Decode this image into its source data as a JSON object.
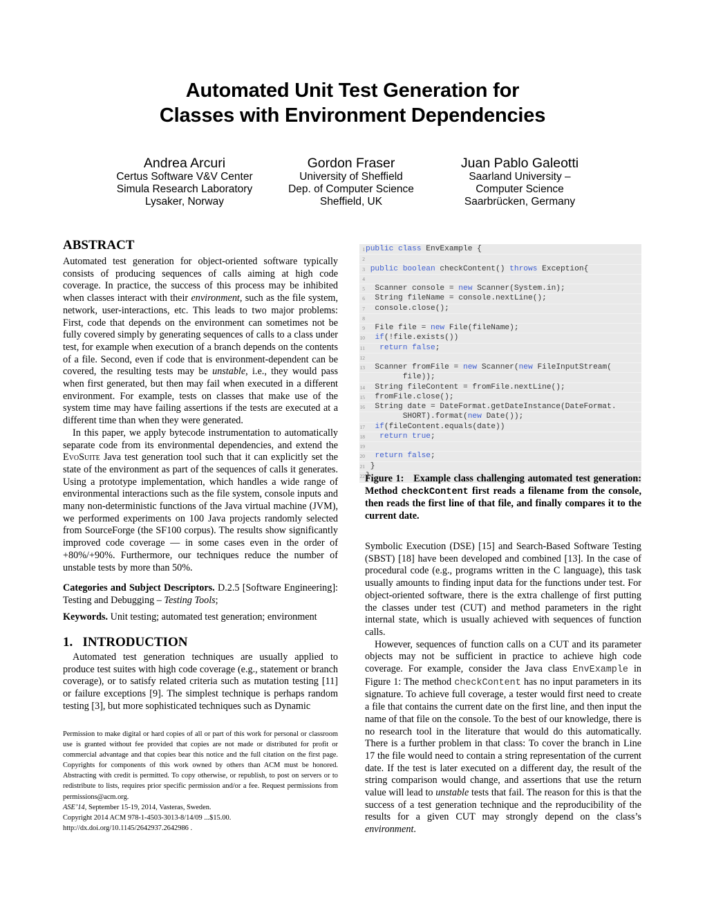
{
  "paper": {
    "title_line1": "Automated Unit Test Generation for",
    "title_line2": "Classes with Environment Dependencies",
    "authors": [
      {
        "name": "Andrea Arcuri",
        "affiliation": [
          "Certus Software V&V Center",
          "Simula Research Laboratory",
          "Lysaker, Norway"
        ]
      },
      {
        "name": "Gordon Fraser",
        "affiliation": [
          "University of Sheffield",
          "Dep. of Computer Science",
          "Sheffield, UK"
        ]
      },
      {
        "name": "Juan Pablo Galeotti",
        "affiliation": [
          "Saarland University –",
          "Computer Science",
          "Saarbrücken, Germany"
        ]
      }
    ]
  },
  "abstract": {
    "heading": "ABSTRACT",
    "p1_a": "Automated test generation for object-oriented software typically consists of producing sequences of calls aiming at high code coverage. In practice, the success of this process may be inhibited when classes interact with their ",
    "p1_em1": "environment",
    "p1_b": ", such as the file system, network, user-interactions, etc. This leads to two major problems: First, code that depends on the environment can sometimes not be fully covered simply by generating sequences of calls to a class under test, for example when execution of a branch depends on the contents of a file. Second, even if code that is environment-dependent can be covered, the resulting tests may be ",
    "p1_em2": "unstable",
    "p1_c": ", i.e., they would pass when first generated, but then may fail when executed in a different environment. For example, tests on classes that make use of the system time may have failing assertions if the tests are executed at a different time than when they were generated.",
    "p2_a": "In this paper, we apply bytecode instrumentation to automatically separate code from its environmental dependencies, and extend the ",
    "p2_tool": "EvoSuite",
    "p2_b": " Java test generation tool such that it can explicitly set the state of the environment as part of the sequences of calls it generates. Using a prototype implementation, which handles a wide range of environmental interactions such as the file system, console inputs and many non-deterministic functions of the Java virtual machine (JVM), we performed experiments on 100 Java projects randomly selected from SourceForge (the SF100 corpus). The results show significantly improved code coverage — in some cases even in the order of +80%/+90%. Furthermore, our techniques reduce the number of unstable tests by more than 50%."
  },
  "categories": {
    "label": "Categories and Subject Descriptors.",
    "text_a": " D.2.5 [Software Engineering]: Testing and Debugging – ",
    "text_em": "Testing Tools",
    "text_b": ";"
  },
  "keywords": {
    "label": "Keywords.",
    "text": " Unit testing; automated test generation; environment"
  },
  "introduction": {
    "heading": "1.   INTRODUCTION",
    "p1_left": "Automated test generation techniques are usually applied to produce test suites with high code coverage (e.g., statement or branch coverage), or to satisfy related criteria such as mutation testing [11] or failure exceptions [9]. The simplest technique is perhaps random testing [3], but more sophisticated techniques such as Dynamic",
    "p1_right": "Symbolic Execution (DSE) [15] and Search-Based Software Testing (SBST) [18] have been developed and combined [13]. In the case of procedural code (e.g., programs written in the C language), this task usually amounts to finding input data for the functions under test. For object-oriented software, there is the extra challenge of first putting the classes under test (CUT) and method parameters in the right internal state, which is usually achieved with sequences of function calls.",
    "p2_a": "However, sequences of function calls on a CUT and its parameter objects may not be sufficient in practice to achieve high code coverage. For example, consider the Java class ",
    "p2_code1": "EnvExample",
    "p2_b": " in Figure 1: The method ",
    "p2_code2": "checkContent",
    "p2_c": " has no input parameters in its signature. To achieve full coverage, a tester would first need to create a file that contains the current date on the first line, and then input the name of that file on the console. To the best of our knowledge, there is no research tool in the literature that would do this automatically. There is a further problem in that class: To cover the branch in Line 17 the file would need to contain a string representation of the current date. If the test is later executed on a different day, the result of the string comparison would change, and assertions that use the return value will lead to ",
    "p2_em1": "unstable",
    "p2_d": " tests that fail. The reason for this is that the success of a test generation technique and the reproducibility of the results for a given CUT may strongly depend on the class’s ",
    "p2_em2": "environment",
    "p2_e": "."
  },
  "permission": {
    "text": "Permission to make digital or hard copies of all or part of this work for personal or classroom use is granted without fee provided that copies are not made or distributed for profit or commercial advantage and that copies bear this notice and the full citation on the first page. Copyrights for components of this work owned by others than ACM must be honored. Abstracting with credit is permitted. To copy otherwise, or republish, to post on servers or to redistribute to lists, requires prior specific permission and/or a fee. Request permissions from permissions@acm.org.",
    "venue_em": "ASE’14,",
    "venue": " September 15-19, 2014, Vasteras, Sweden.",
    "copyright": "Copyright 2014 ACM 978-1-4503-3013-8/14/09 ...$15.00.",
    "doi": "http://dx.doi.org/10.1145/2642937.2642986 ."
  },
  "figure1": {
    "keyword_color": "#3f5fd0",
    "background_color": "#e9e9e9",
    "code_lines": [
      {
        "n": "1",
        "segs": [
          [
            "kw",
            "public class"
          ],
          [
            "t",
            " EnvExample {"
          ]
        ]
      },
      {
        "n": "2",
        "segs": []
      },
      {
        "n": "3",
        "segs": [
          [
            "t",
            " "
          ],
          [
            "kw",
            "public boolean"
          ],
          [
            "t",
            " checkContent() "
          ],
          [
            "kw",
            "throws"
          ],
          [
            "t",
            " Exception{"
          ]
        ]
      },
      {
        "n": "4",
        "segs": []
      },
      {
        "n": "5",
        "segs": [
          [
            "t",
            "  Scanner console = "
          ],
          [
            "kw",
            "new"
          ],
          [
            "t",
            " Scanner(System.in);"
          ]
        ]
      },
      {
        "n": "6",
        "segs": [
          [
            "t",
            "  String fileName = console.nextLine();"
          ]
        ]
      },
      {
        "n": "7",
        "segs": [
          [
            "t",
            "  console.close();"
          ]
        ]
      },
      {
        "n": "8",
        "segs": []
      },
      {
        "n": "9",
        "segs": [
          [
            "t",
            "  File file = "
          ],
          [
            "kw",
            "new"
          ],
          [
            "t",
            " File(fileName);"
          ]
        ]
      },
      {
        "n": "10",
        "segs": [
          [
            "t",
            "  "
          ],
          [
            "kw",
            "if"
          ],
          [
            "t",
            "(!file.exists())"
          ]
        ]
      },
      {
        "n": "11",
        "segs": [
          [
            "t",
            "   "
          ],
          [
            "kw",
            "return false"
          ],
          [
            "t",
            ";"
          ]
        ]
      },
      {
        "n": "12",
        "segs": []
      },
      {
        "n": "13",
        "segs": [
          [
            "t",
            "  Scanner fromFile = "
          ],
          [
            "kw",
            "new"
          ],
          [
            "t",
            " Scanner("
          ],
          [
            "kw",
            "new"
          ],
          [
            "t",
            " FileInputStream("
          ]
        ]
      },
      {
        "n": "",
        "segs": [
          [
            "t",
            "        file));"
          ]
        ]
      },
      {
        "n": "14",
        "segs": [
          [
            "t",
            "  String fileContent = fromFile.nextLine();"
          ]
        ]
      },
      {
        "n": "15",
        "segs": [
          [
            "t",
            "  fromFile.close();"
          ]
        ]
      },
      {
        "n": "16",
        "segs": [
          [
            "t",
            "  String date = DateFormat.getDateInstance(DateFormat."
          ]
        ]
      },
      {
        "n": "",
        "segs": [
          [
            "t",
            "        SHORT).format("
          ],
          [
            "kw",
            "new"
          ],
          [
            "t",
            " Date());"
          ]
        ]
      },
      {
        "n": "17",
        "segs": [
          [
            "t",
            "  "
          ],
          [
            "kw",
            "if"
          ],
          [
            "t",
            "(fileContent.equals(date))"
          ]
        ]
      },
      {
        "n": "18",
        "segs": [
          [
            "t",
            "   "
          ],
          [
            "kw",
            "return true"
          ],
          [
            "t",
            ";"
          ]
        ]
      },
      {
        "n": "19",
        "segs": []
      },
      {
        "n": "20",
        "segs": [
          [
            "t",
            "  "
          ],
          [
            "kw",
            "return false"
          ],
          [
            "t",
            ";"
          ]
        ]
      },
      {
        "n": "21",
        "segs": [
          [
            "t",
            " }"
          ]
        ]
      },
      {
        "n": "22",
        "segs": [
          [
            "t",
            "}"
          ]
        ]
      }
    ],
    "caption_label": "Figure 1:",
    "caption_a": "   Example class challenging automated test generation: Method ",
    "caption_code": "checkContent",
    "caption_b": " first reads a filename from the console, then reads the first line of that file, and finally compares it to the current date."
  }
}
